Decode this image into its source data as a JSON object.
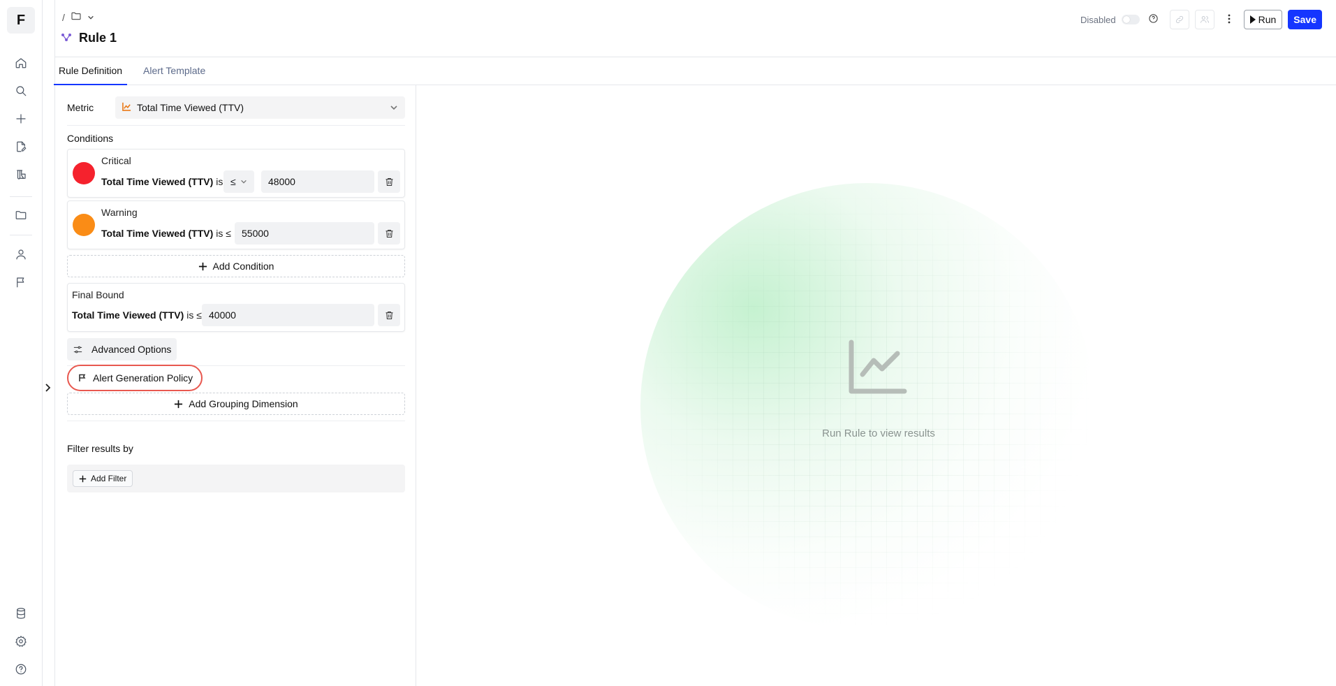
{
  "nav": {
    "logo": "F",
    "icons": [
      "home-icon",
      "search-icon",
      "plus-icon",
      "document-edit-icon",
      "lab-icon",
      "folder-icon",
      "user-icon",
      "flag-icon",
      "database-icon",
      "gear-icon",
      "help-icon"
    ]
  },
  "header": {
    "breadcrumb_separator": "/",
    "title": "Rule 1",
    "status_label": "Disabled",
    "run_label": "Run",
    "save_label": "Save",
    "colors": {
      "primary": "#1536ff"
    }
  },
  "tabs": [
    {
      "label": "Rule Definition",
      "active": true
    },
    {
      "label": "Alert Template",
      "active": false
    }
  ],
  "rule": {
    "metric_label": "Metric",
    "metric_value": "Total Time Viewed (TTV)",
    "conditions_label": "Conditions",
    "conditions": [
      {
        "name": "Critical",
        "color": "#f5222d",
        "metric": "Total Time Viewed (TTV)",
        "is": "is",
        "operator": "≤",
        "value": "48000"
      },
      {
        "name": "Warning",
        "color": "#fa8c16",
        "metric": "Total Time Viewed (TTV)",
        "is": "is ≤",
        "value": "55000"
      }
    ],
    "add_condition_label": "Add Condition",
    "final_bound": {
      "name": "Final Bound",
      "metric": "Total Time Viewed (TTV)",
      "is": "is ≤",
      "value": "40000"
    },
    "advanced_options_label": "Advanced Options",
    "alert_policy_label": "Alert Generation Policy",
    "add_grouping_label": "Add Grouping Dimension",
    "filter_label": "Filter results by",
    "add_filter_label": "Add Filter"
  },
  "results": {
    "empty_message": "Run Rule to view results"
  }
}
